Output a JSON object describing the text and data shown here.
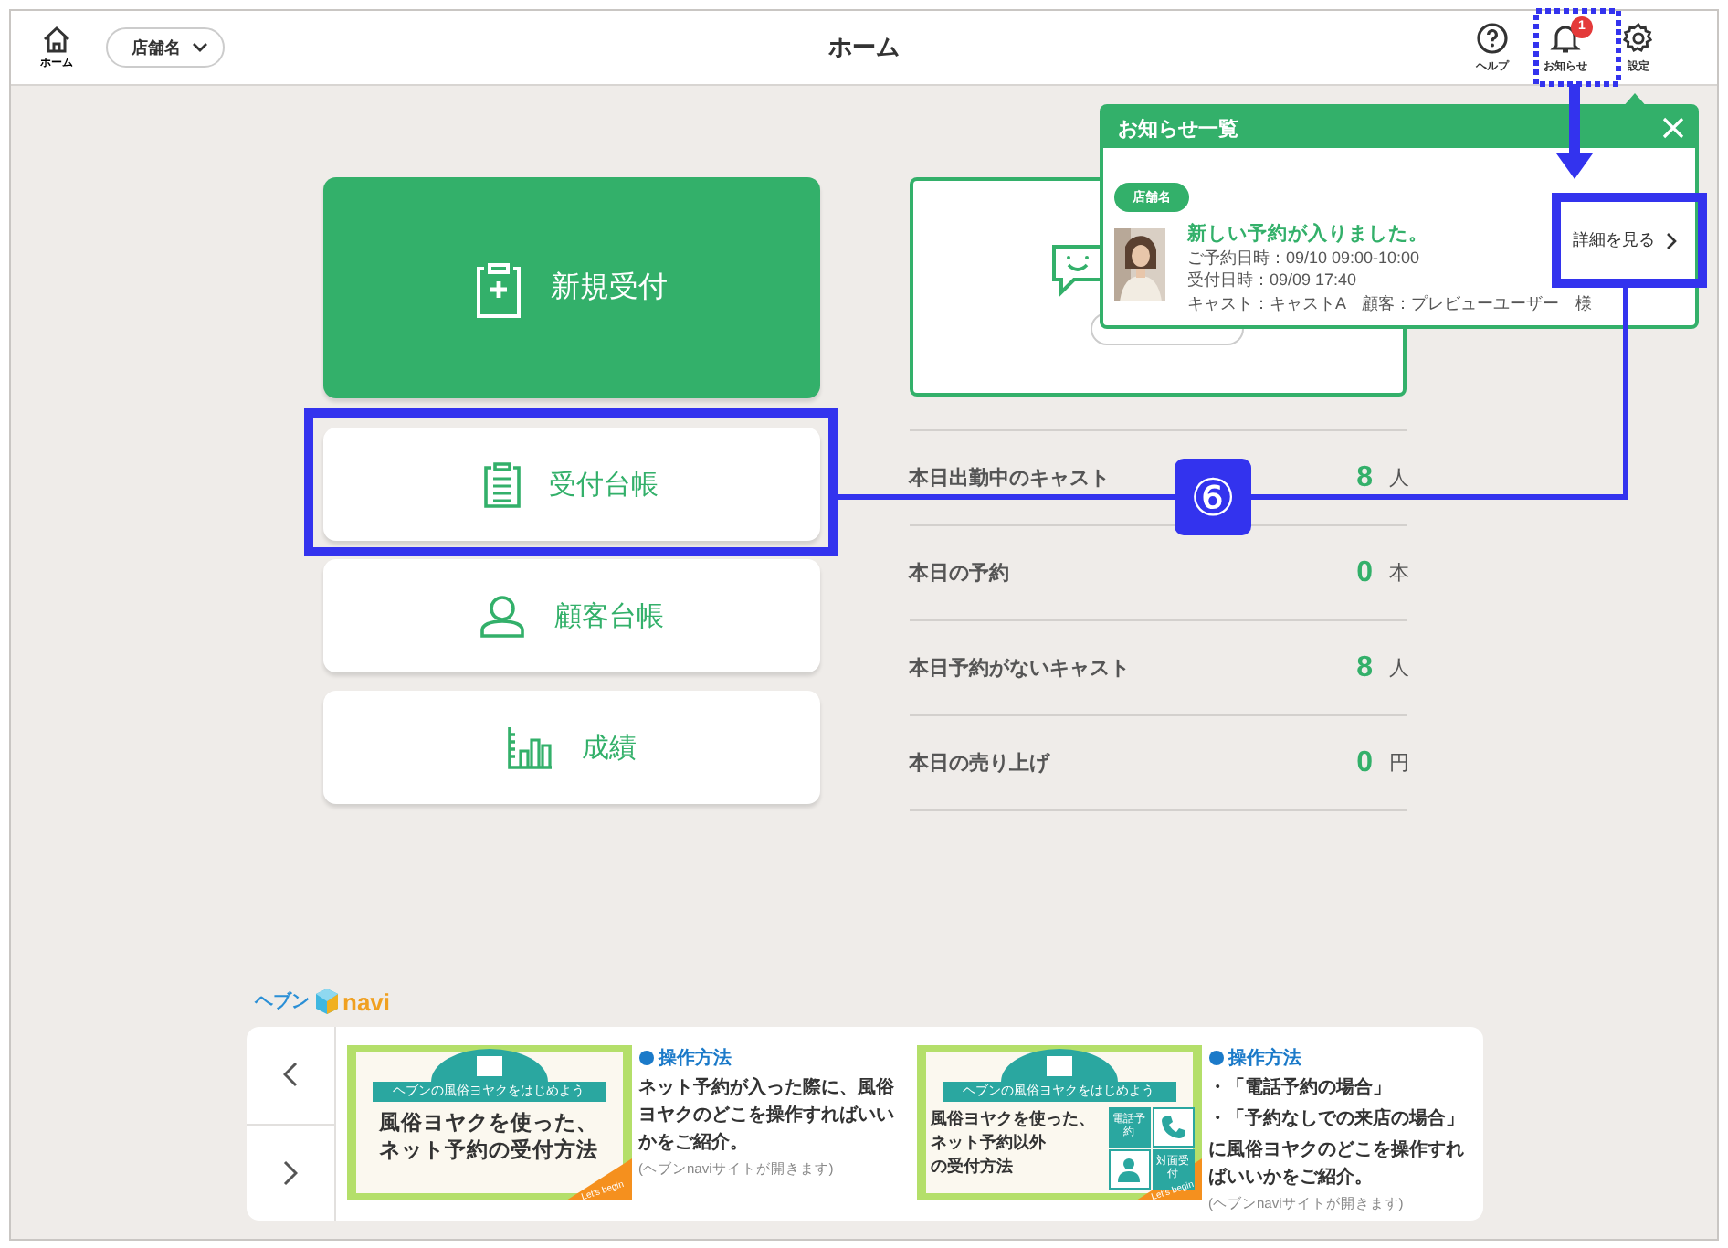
{
  "header": {
    "home_label": "ホーム",
    "store_select": "店舗名",
    "title": "ホーム",
    "actions": [
      {
        "kind": "help",
        "label": "ヘルプ"
      },
      {
        "kind": "notifications",
        "label": "お知らせ",
        "badge": "1"
      },
      {
        "kind": "settings",
        "label": "設定"
      }
    ]
  },
  "menu": [
    {
      "kind": "new",
      "label": "新規受付"
    },
    {
      "kind": "ledger",
      "label": "受付台帳"
    },
    {
      "kind": "customers",
      "label": "顧客台帳"
    },
    {
      "kind": "results",
      "label": "成績"
    }
  ],
  "stats": [
    {
      "label": "本日出勤中のキャスト",
      "value": "8",
      "unit": "人"
    },
    {
      "label": "本日の予約",
      "value": "0",
      "unit": "本"
    },
    {
      "label": "本日予約がないキャスト",
      "value": "8",
      "unit": "人"
    },
    {
      "label": "本日の売り上げ",
      "value": "0",
      "unit": "円"
    }
  ],
  "notifications_popup": {
    "title": "お知らせ一覧",
    "items": [
      {
        "store": "店舗名",
        "headline": "新しい予約が入りました。",
        "lines": [
          "ご予約日時：09/10 09:00-10:00",
          "受付日時：09/09 17:40",
          "キャスト：キャストA　顧客：プレビューユーザー　様"
        ],
        "link": "詳細を見る"
      }
    ]
  },
  "navi": {
    "logo_left": "ヘブン",
    "logo_right": "navi",
    "banners": [
      {
        "kind": "online",
        "ribbon": "ヘブンの風俗ヨヤクをはじめよう",
        "headline": [
          "風俗ヨヤクを使った、",
          "ネット予約の受付方法"
        ],
        "corner": "Let's begin",
        "heading": "操作方法",
        "lines": [
          "ネット予約が入った際に、風俗ヨヤクのどこを操作すればいいかをご紹介。"
        ],
        "note": "(ヘブンnaviサイトが開きます)"
      },
      {
        "kind": "offline",
        "ribbon": "ヘブンの風俗ヨヤクをはじめよう",
        "headline": [
          "風俗ヨヤクを使った、",
          "ネット予約以外",
          "の受付方法"
        ],
        "tiles": [
          "電話予約",
          "対面受付"
        ],
        "corner": "Let's begin",
        "heading": "操作方法",
        "lines": [
          "・「電話予約の場合」",
          "・「予約なしでの来店の場合」",
          "に風俗ヨヤクのどこを操作すればいいかをご紹介。"
        ],
        "note": "(ヘブンnaviサイトが開きます)"
      }
    ]
  },
  "annotation": {
    "step_label": "⑥"
  }
}
